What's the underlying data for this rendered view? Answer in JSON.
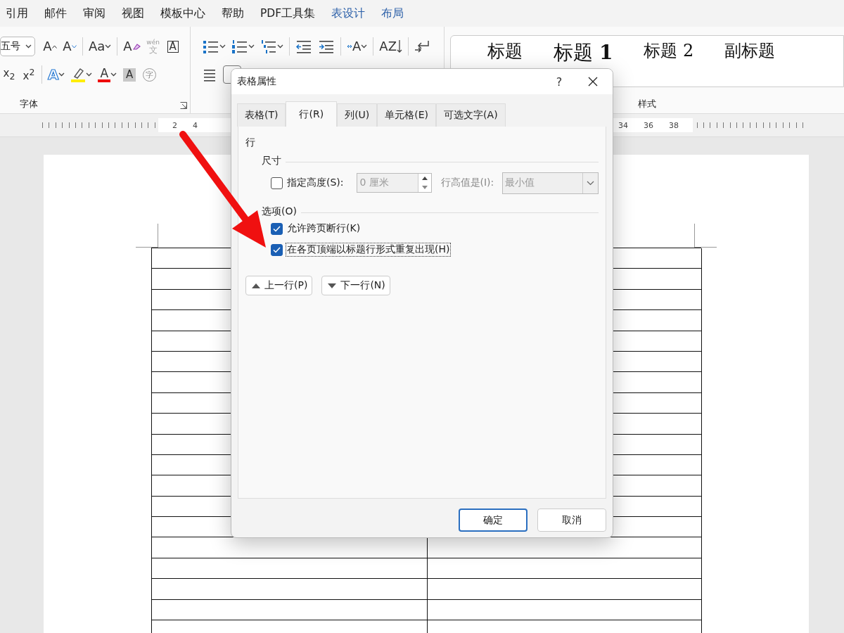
{
  "menu_tabs": [
    {
      "label": "引用",
      "kind": "normal"
    },
    {
      "label": "邮件",
      "kind": "normal"
    },
    {
      "label": "审阅",
      "kind": "normal"
    },
    {
      "label": "视图",
      "kind": "normal"
    },
    {
      "label": "模板中心",
      "kind": "normal"
    },
    {
      "label": "帮助",
      "kind": "normal"
    },
    {
      "label": "PDF工具集",
      "kind": "normal"
    },
    {
      "label": "表设计",
      "kind": "contextual"
    },
    {
      "label": "布局",
      "kind": "contextual"
    }
  ],
  "ribbon": {
    "font_group": {
      "size_field": {
        "value": "五号"
      },
      "row_1": [
        {
          "kind": "grow",
          "glyph": "A"
        },
        {
          "kind": "shrink",
          "glyph": "A"
        },
        {
          "kind": "case",
          "glyph": "Aa"
        },
        {
          "kind": "clear",
          "glyph": "A"
        },
        {
          "kind": "pinyin",
          "glyph": "文",
          "ruby": "wén"
        },
        {
          "kind": "border",
          "glyph": "A"
        }
      ],
      "row_2": [
        {
          "kind": "script",
          "glyph": "x$_{2}$"
        },
        {
          "kind": "script",
          "glyph": "x$^{2}$"
        },
        {
          "kind": "effects",
          "glyph": "A"
        },
        {
          "kind": "highlight"
        },
        {
          "kind": "color",
          "glyph": "A"
        },
        {
          "kind": "shading",
          "glyph": "A"
        },
        {
          "kind": "enclose",
          "glyph": "字"
        }
      ],
      "label": "字体"
    },
    "paragraph_group": {
      "row_1": [
        {
          "kind": "bullets"
        },
        {
          "kind": "numbering"
        },
        {
          "kind": "multilevel"
        },
        {
          "kind": "outdent"
        },
        {
          "kind": "indent"
        },
        {
          "kind": "direction",
          "glyph": "A"
        },
        {
          "kind": "sort",
          "glyph": "A",
          "glyph_2": "Z"
        },
        {
          "kind": "break"
        }
      ],
      "row_2": [
        {
          "kind": "align"
        },
        {
          "kind": "box"
        }
      ]
    },
    "styles_group": {
      "items": [
        {
          "label": "标题",
          "kind": "title"
        },
        {
          "label": "标题 **1**",
          "kind": "heading"
        },
        {
          "label": "标题 2",
          "kind": "normal"
        },
        {
          "label": "副标题",
          "kind": "normal"
        }
      ],
      "label": "样式"
    }
  },
  "ruler": {
    "left_labels": [
      "2",
      "4"
    ],
    "right_labels": [
      "34",
      "36",
      "38"
    ]
  },
  "dialog": {
    "title": "表格属性",
    "help": "?",
    "tabs": [
      {
        "label": "表格(T)",
        "selected": false
      },
      {
        "label": "行(R)",
        "selected": true
      },
      {
        "label": "列(U)",
        "selected": false
      },
      {
        "label": "单元格(E)",
        "selected": false
      },
      {
        "label": "可选文字(A)",
        "selected": false
      }
    ],
    "section": "行",
    "size_group": {
      "title": "尺寸",
      "height_checkbox": {
        "label": "指定高度(S):",
        "checked": false
      },
      "height_field": {
        "value": "0 厘米",
        "disabled": true
      },
      "mode_label": "行高值是(I):",
      "mode_dropdown": {
        "value": "最小值",
        "disabled": true
      }
    },
    "options_group": {
      "title": "选项(O)",
      "checkboxes": [
        {
          "label": "允许跨页断行(K)",
          "checked": true,
          "focused": false
        },
        {
          "label": "在各页顶端以标题行形式重复出现(H)",
          "checked": true,
          "focused": true
        }
      ]
    },
    "nav_buttons": [
      {
        "label": "上一行(P)",
        "kind": "up"
      },
      {
        "label": "下一行(N)",
        "kind": "down"
      }
    ],
    "buttons": [
      {
        "label": "确定",
        "kind": "default"
      },
      {
        "label": "取消",
        "kind": "normal"
      }
    ]
  }
}
